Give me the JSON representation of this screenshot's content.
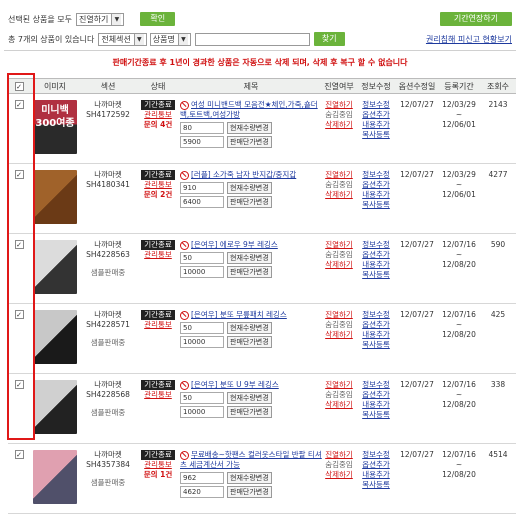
{
  "top": {
    "selected_label": "선택된 상품을 모두",
    "action_select": "진열하기",
    "confirm_button": "확인",
    "period_button": "기간연장하기"
  },
  "search": {
    "count_text": "총 7개의 상품이 있습니다",
    "category_select": "전체섹션",
    "field_select": "상품명",
    "search_button": "찾기",
    "right_link": "권리침해 피신고 현황보기"
  },
  "notice": "판매기간종료 후 1년이 경과한 상품은 자동으로 삭제 되며, 삭제 후 복구 할 수 없습니다",
  "columns": [
    "",
    "이미지",
    "섹션",
    "상태",
    "제목",
    "진열여부",
    "정보수정",
    "옵션수정일",
    "등록기간",
    "조회수"
  ],
  "row_labels": {
    "badge": "기간종료",
    "manage": "관리통보",
    "display": "진열하기",
    "hidden": "숨김중임",
    "delete": "삭제하기",
    "edit_info": "정보수정",
    "edit_option": "옵션추가",
    "edit_content": "내용추가",
    "copy": "복사등록",
    "qty_btn": "현재수량변경",
    "price_btn": "판매단가변경"
  },
  "rows": [
    {
      "shop": "나까마켓",
      "code": "SH4172592",
      "sub": "",
      "inquiry": "문의 4건",
      "title": "여성 미니밴드백 모음전★체인,가죽,숄더백,토트백,여성가방",
      "qty": "80",
      "price": "5900",
      "date": "12/07/27",
      "period_start": "12/03/29",
      "period_end": "12/06/01",
      "views": "2143",
      "color1": "#b03040",
      "color2": "#2a2a2a",
      "thumb_text": "미니백\n300여종"
    },
    {
      "shop": "나까마켓",
      "code": "SH4180341",
      "sub": "",
      "inquiry": "문의 2건",
      "title": "[러플] 소가죽 남자 반지갑/중지갑",
      "qty": "910",
      "price": "6400",
      "date": "12/07/27",
      "period_start": "12/03/29",
      "period_end": "12/06/01",
      "views": "4277",
      "color1": "#a0622a",
      "color2": "#6b3a16",
      "thumb_text": ""
    },
    {
      "shop": "나까마켓",
      "code": "SH4228563",
      "sub": "샘플판매중",
      "inquiry": "",
      "title": "[은여우] 에로우 9부 레깅스",
      "qty": "50",
      "price": "10000",
      "date": "12/07/27",
      "period_start": "12/07/16",
      "period_end": "12/08/20",
      "views": "590",
      "color1": "#dcdcdc",
      "color2": "#333",
      "thumb_text": ""
    },
    {
      "shop": "나까마켓",
      "code": "SH4228571",
      "sub": "샘플판매중",
      "inquiry": "",
      "title": "[은여우] 분또 무릎패치 레깅스",
      "qty": "50",
      "price": "10000",
      "date": "12/07/27",
      "period_start": "12/07/16",
      "period_end": "12/08/20",
      "views": "425",
      "color1": "#c8c8c8",
      "color2": "#1a1a1a",
      "thumb_text": ""
    },
    {
      "shop": "나까마켓",
      "code": "SH4228568",
      "sub": "샘플판매중",
      "inquiry": "",
      "title": "[은여우] 분또 U 9부 레깅스",
      "qty": "50",
      "price": "10000",
      "date": "12/07/27",
      "period_start": "12/07/16",
      "period_end": "12/08/20",
      "views": "338",
      "color1": "#d0d0d0",
      "color2": "#222",
      "thumb_text": ""
    },
    {
      "shop": "나까마켓",
      "code": "SH4357384",
      "sub": "샘플판매중",
      "inquiry": "문의 1건",
      "title": "무료배송~핫팬스 컬러웃스타일 반팔 티셔츠 세금계산서 가능",
      "qty": "962",
      "price": "4620",
      "date": "12/07/27",
      "period_start": "12/07/16",
      "period_end": "12/08/20",
      "views": "4514",
      "color1": "#e0a0b0",
      "color2": "#50506a",
      "thumb_text": ""
    }
  ],
  "colors": {
    "accent_green": "#6bb33b",
    "alert_red": "#d01010",
    "link_blue": "#1e3a9e",
    "highlight_box": "#e01818"
  }
}
